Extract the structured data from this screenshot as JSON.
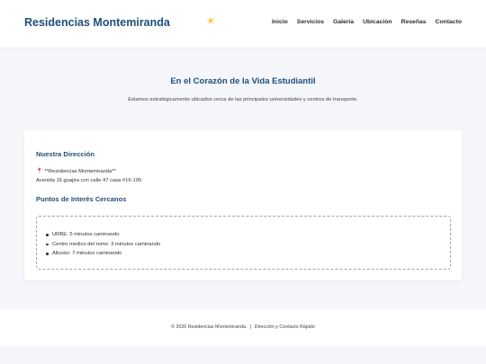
{
  "header": {
    "brand": "Residencias Montemiranda",
    "sun_icon": "☀",
    "nav": [
      "Inicio",
      "Servicios",
      "Galería",
      "Ubicación",
      "Reseñas",
      "Contacto"
    ]
  },
  "location": {
    "title": "En el Corazón de la Vida Estudiantil",
    "subtitle": "Estamos estratégicamente ubicados cerca de las principales universidades y centros de transporte."
  },
  "address": {
    "heading": "Nuestra Dirección",
    "pin_icon": "📍",
    "name": "**Residencias Montemiranda**",
    "line": "Avenida 16 guajira con calle 47 casa #16-195"
  },
  "poi": {
    "heading": "Puntos de Interés Cercanos",
    "items": [
      "URBE: 5 minutos caminando",
      "Centro medico del norte: 3 minutos caminando",
      "Alkosto: 7 minutos caminando"
    ]
  },
  "footer": {
    "copyright": "© 2026 Residencias Montemiranda.",
    "separator": "|",
    "link": "Dirección y Contacto Rápido"
  },
  "colors": {
    "accent": "#1f4e79",
    "background": "#f4f6f9",
    "sun": "#f2b705"
  }
}
